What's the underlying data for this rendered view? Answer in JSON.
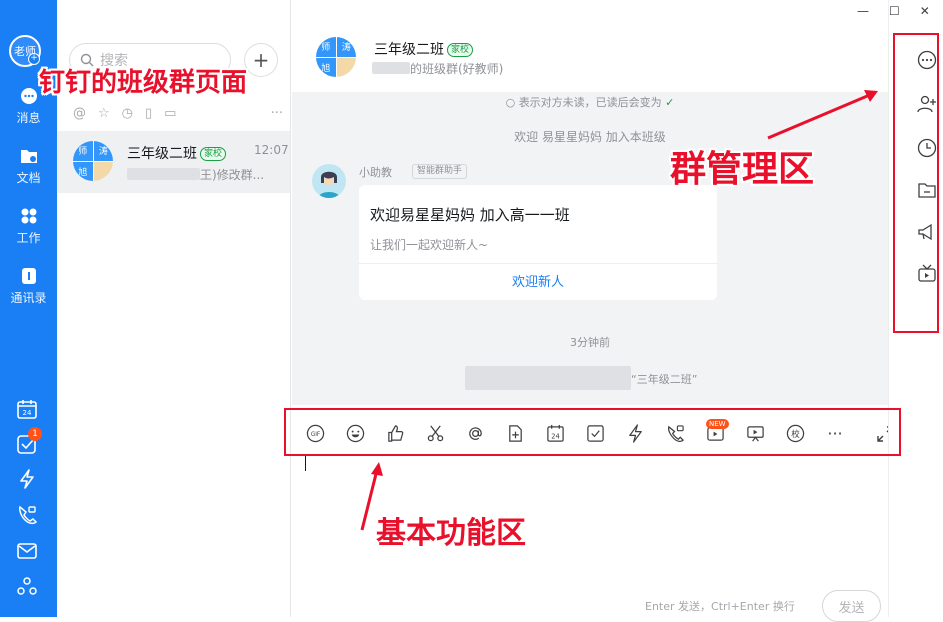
{
  "window": {
    "controls": [
      "—",
      "☐",
      "✕"
    ]
  },
  "nav": {
    "avatar_text": "老师",
    "items": [
      {
        "label": "消息",
        "icon": "chat-bubble-icon"
      },
      {
        "label": "文档",
        "icon": "document-folder-icon"
      },
      {
        "label": "工作",
        "icon": "grid-apps-icon"
      },
      {
        "label": "通讯录",
        "icon": "contacts-book-icon"
      }
    ],
    "bottom_icons": [
      "calendar-icon",
      "todo-check-icon",
      "flash-icon",
      "phone-video-icon",
      "mail-icon",
      "more-apps-icon"
    ],
    "calendar_day": "24",
    "todo_badge": "1"
  },
  "conversations": {
    "search_placeholder": "搜索",
    "add_label": "+",
    "more_label": "···",
    "items": [
      {
        "title": "三年级二班",
        "tag": "家校",
        "time": "12:07",
        "preview": "王)修改群..."
      }
    ]
  },
  "chat": {
    "title": "三年级二班",
    "tag": "家校",
    "subtitle": "的班级群(好教师)",
    "avatar_tiles": [
      "师",
      "涛",
      "旭"
    ],
    "read_note": "表示对方未读，已读后会变为",
    "welcome_note": "欢迎 易星星妈妈 加入本班级",
    "bot": {
      "name": "小助教",
      "tag": "智能群助手"
    },
    "card": {
      "title": "欢迎易星星妈妈 加入高一一班",
      "body": "让我们一起欢迎新人~",
      "action": "欢迎新人"
    },
    "time_sep": "3分钟前",
    "sys_msg": "“三年级二班”",
    "toolbar": {
      "new_badge": "NEW",
      "gif_label": "GIF",
      "school_label": "校",
      "more_label": "···",
      "calendar_day": "24"
    },
    "input": {
      "hint": "Enter 发送，Ctrl+Enter 换行",
      "send_label": "发送"
    }
  },
  "annotations": {
    "page_label": "钉钉的班级群页面",
    "group_mgmt_label": "群管理区",
    "basic_func_label": "基本功能区",
    "color": "#e8102b"
  },
  "colors": {
    "brand": "#1a7ff5",
    "tag_green": "#1a9f45",
    "badge_red": "#ff5219"
  }
}
